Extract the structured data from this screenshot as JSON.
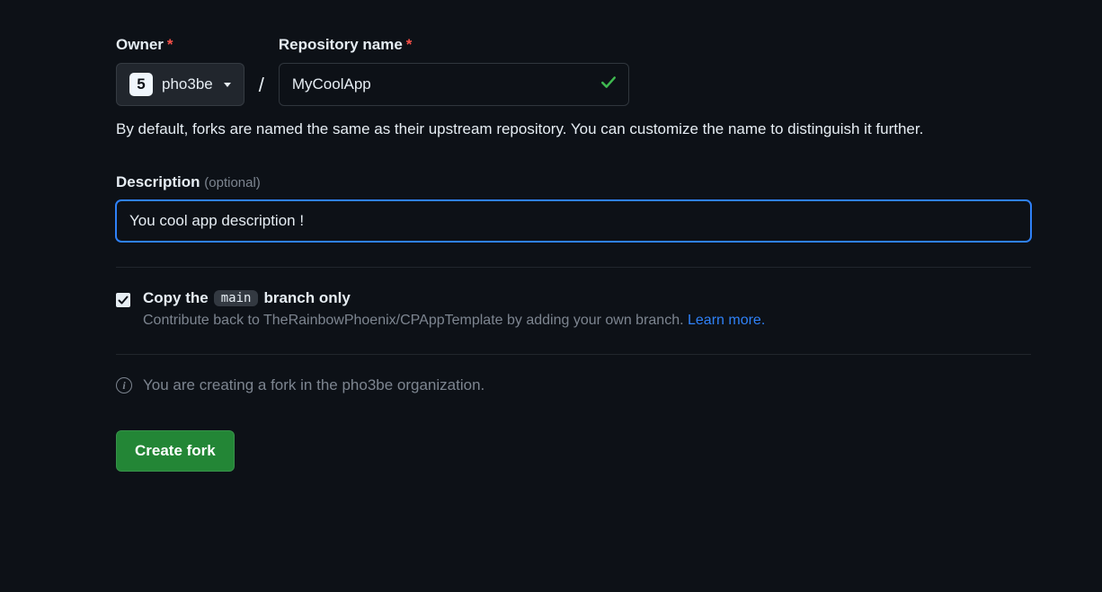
{
  "owner": {
    "label": "Owner",
    "name": "pho3be",
    "avatar_letter": "5"
  },
  "repo": {
    "label": "Repository name",
    "value": "MyCoolApp"
  },
  "help_text": "By default, forks are named the same as their upstream repository. You can customize the name to distinguish it further.",
  "description": {
    "label": "Description",
    "optional": "(optional)",
    "value": "You cool app description !"
  },
  "copy_branch": {
    "prefix": "Copy the",
    "branch": "main",
    "suffix": "branch only",
    "help": "Contribute back to TheRainbowPhoenix/CPAppTemplate by adding your own branch. ",
    "learn_more": "Learn more."
  },
  "info_text": "You are creating a fork in the pho3be organization.",
  "create_button": "Create fork",
  "required_marker": "*"
}
